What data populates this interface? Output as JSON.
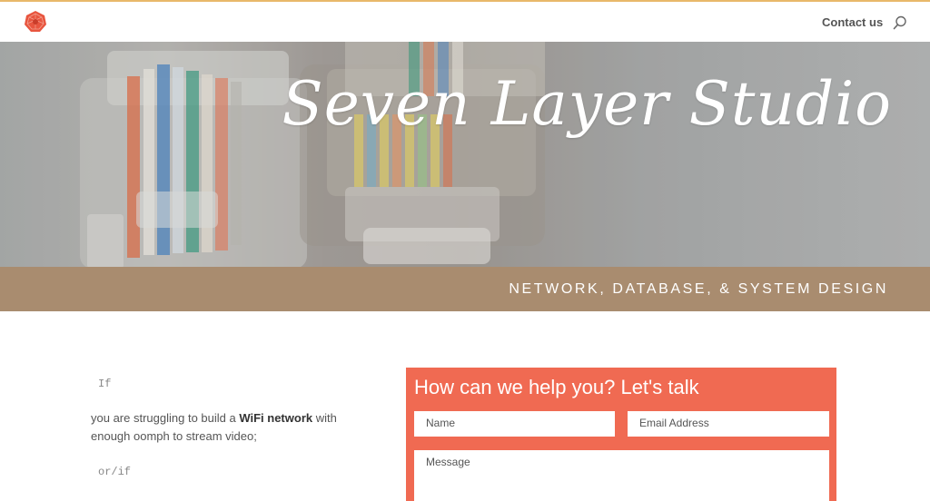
{
  "header": {
    "nav_contact": "Contact us",
    "logo_icon": "geometric-logo-icon",
    "search_icon": "search-icon"
  },
  "hero": {
    "title": "Seven Layer Studio",
    "tagline": "NETWORK, DATABASE, & SYSTEM DESIGN"
  },
  "content": {
    "if_label": "If",
    "para_pre": "you are struggling to build a ",
    "para_bold": "WiFi network",
    "para_post": " with enough oomph to stream video;",
    "orif_label": "or/if"
  },
  "form": {
    "title": "How can we help you? Let's talk",
    "name_placeholder": "Name",
    "email_placeholder": "Email Address",
    "message_placeholder": "Message"
  },
  "colors": {
    "accent_top": "#e8b86a",
    "band": "#a98c6f",
    "form_bg": "#f06a52",
    "logo": "#e8553f"
  }
}
